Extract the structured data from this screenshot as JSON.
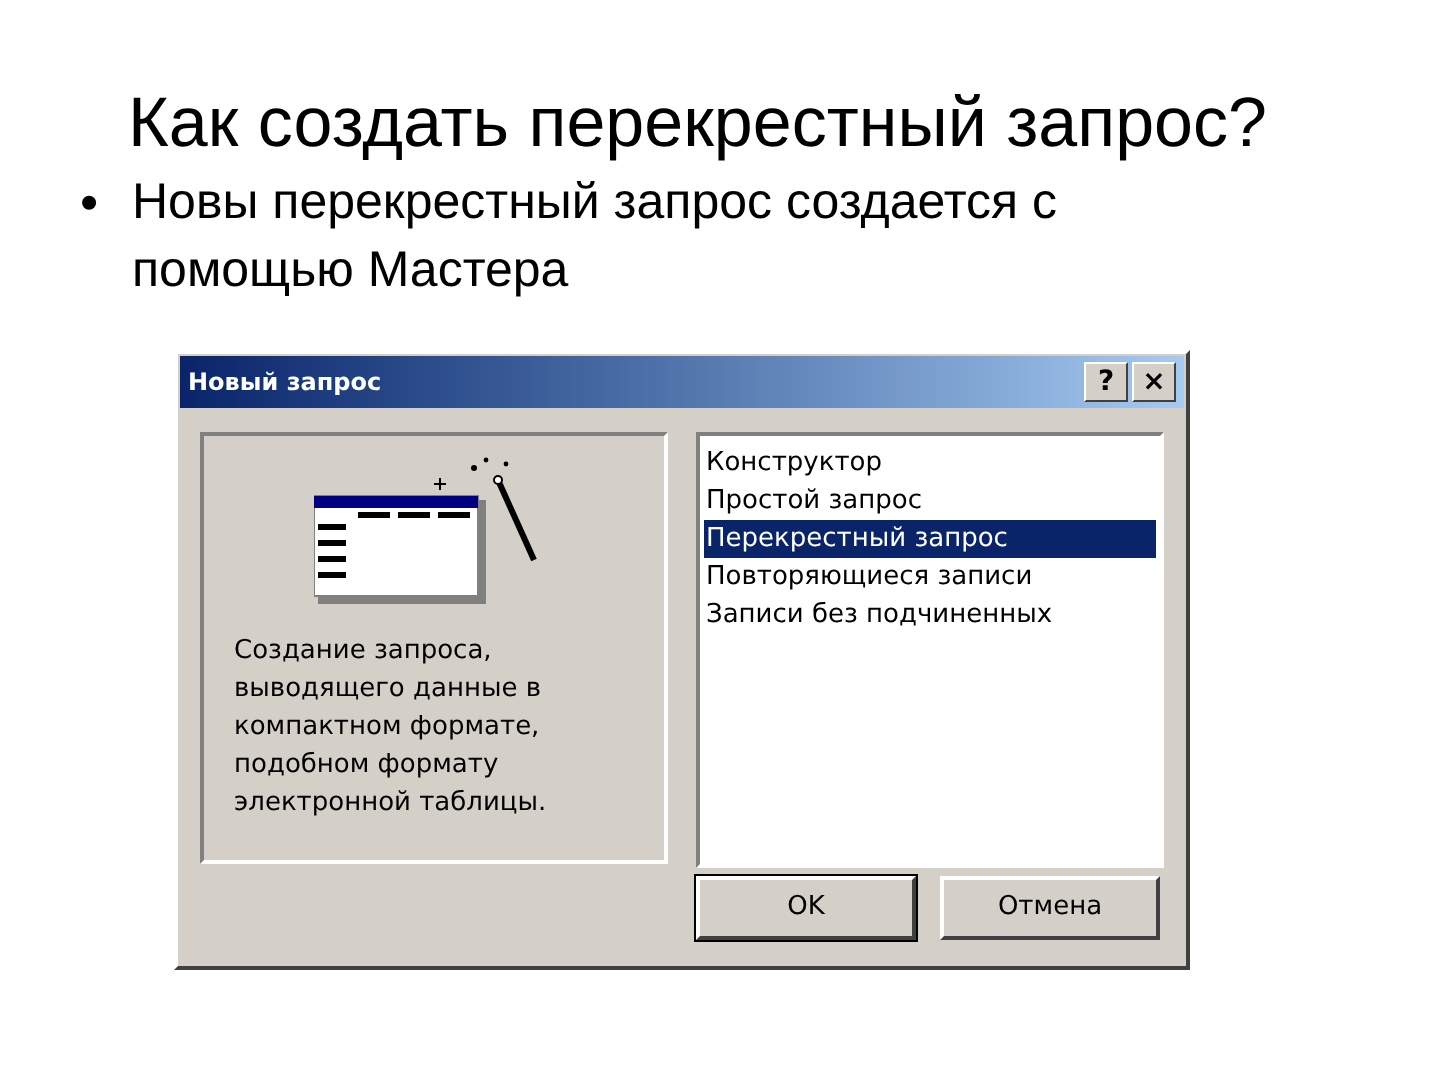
{
  "slide": {
    "title": "Как создать перекрестный запрос?",
    "bullets": [
      {
        "marker": "•",
        "text": "Новы перекрестный запрос создается с помощью Мастера"
      }
    ]
  },
  "dialog": {
    "title": "Новый запрос",
    "title_buttons": [
      "?",
      "×"
    ],
    "description": "Создание запроса, выводящего данные в компактном формате, подобном формату электронной таблицы.",
    "options": [
      {
        "label": "Конструктор",
        "selected": false
      },
      {
        "label": "Простой запрос",
        "selected": false
      },
      {
        "label": "Перекрестный запрос",
        "selected": true
      },
      {
        "label": "Повторяющиеся записи",
        "selected": false
      },
      {
        "label": "Записи без подчиненных",
        "selected": false
      }
    ],
    "buttons": [
      {
        "label": "OK",
        "default": true
      },
      {
        "label": "Отмена",
        "default": false
      }
    ]
  }
}
